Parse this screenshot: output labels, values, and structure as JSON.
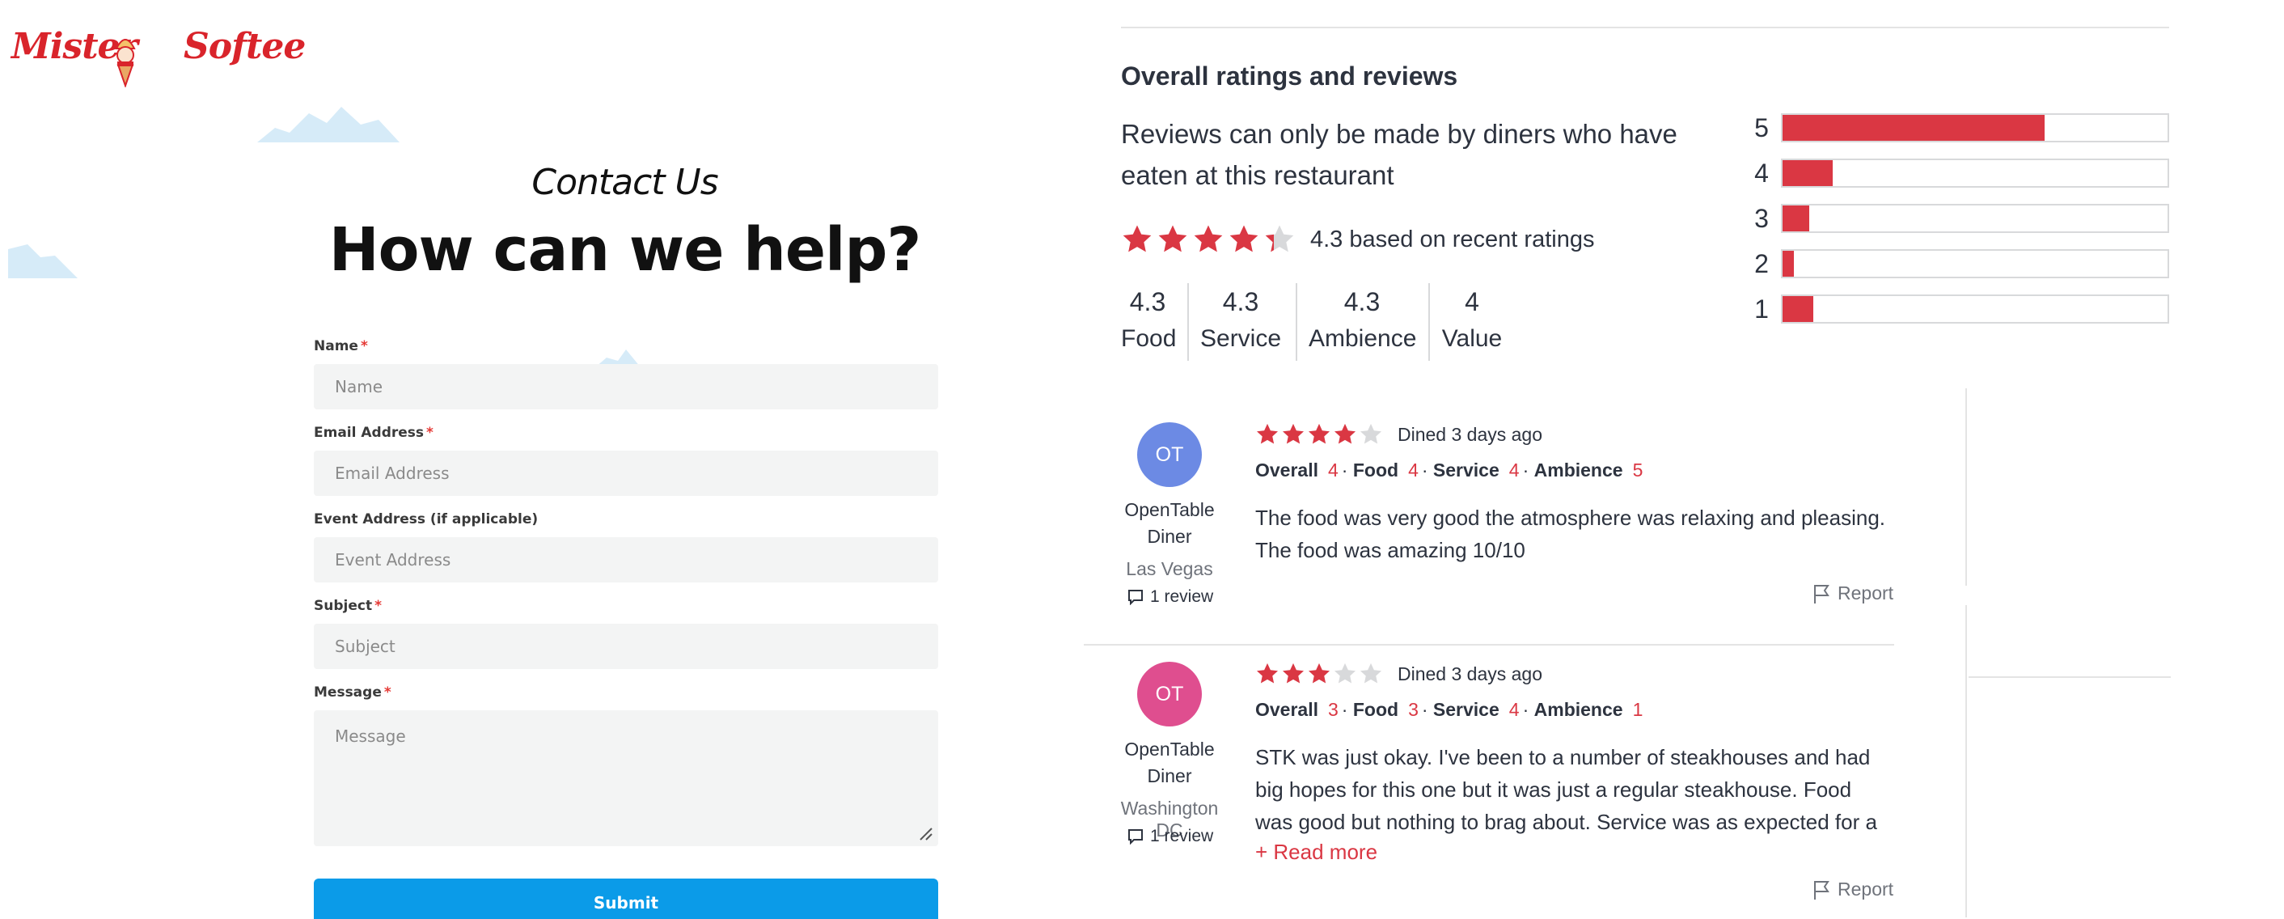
{
  "brand": {
    "logo_text": "Mister Softee",
    "accent": "#d9242b"
  },
  "contact": {
    "kicker": "Contact Us",
    "title": "How can we help?",
    "fields": [
      {
        "label": "Name",
        "required": true,
        "placeholder": "Name"
      },
      {
        "label": "Email Address",
        "required": true,
        "placeholder": "Email Address"
      },
      {
        "label": "Event Address (if applicable)",
        "required": false,
        "placeholder": "Event Address"
      },
      {
        "label": "Subject",
        "required": true,
        "placeholder": "Subject"
      },
      {
        "label": "Message",
        "required": true,
        "placeholder": "Message"
      }
    ],
    "required_mark": "*",
    "submit_label": "Submit",
    "submit_color": "#0b9be8"
  },
  "ratings": {
    "section_title": "Overall ratings and reviews",
    "intro": "Reviews can only be made by diners who have eaten at this restaurant",
    "overall_stars": 4.3,
    "overall_text": "4.3 based on recent ratings",
    "categories": [
      {
        "value": "4.3",
        "label": "Food"
      },
      {
        "value": "4.3",
        "label": "Service"
      },
      {
        "value": "4.3",
        "label": "Ambience"
      },
      {
        "value": "4",
        "label": "Value"
      }
    ],
    "distribution": [
      {
        "stars": "5",
        "fraction": 0.68
      },
      {
        "stars": "4",
        "fraction": 0.13
      },
      {
        "stars": "3",
        "fraction": 0.07
      },
      {
        "stars": "2",
        "fraction": 0.03
      },
      {
        "stars": "1",
        "fraction": 0.08
      }
    ],
    "star_color": "#da3743",
    "star_empty_color": "#d8d9db"
  },
  "reviews": [
    {
      "initials": "OT",
      "avatar_color": "#6c8ae4",
      "name": "OpenTable Diner",
      "location": "Las Vegas",
      "review_count": "1 review",
      "stars": 4,
      "dined": "Dined 3 days ago",
      "overall_label": "Overall",
      "overall": "4",
      "food_label": "Food",
      "food": "4",
      "service_label": "Service",
      "service": "4",
      "ambience_label": "Ambience",
      "ambience": "5",
      "text": "The food was very good the atmosphere was relaxing and pleasing. The food was amazing 10/10",
      "read_more": "",
      "report": "Report"
    },
    {
      "initials": "OT",
      "avatar_color": "#df4e8f",
      "name": "OpenTable Diner",
      "location": "Washington DC",
      "review_count": "1 review",
      "stars": 3,
      "dined": "Dined 3 days ago",
      "overall_label": "Overall",
      "overall": "3",
      "food_label": "Food",
      "food": "3",
      "service_label": "Service",
      "service": "4",
      "ambience_label": "Ambience",
      "ambience": "1",
      "text": "STK was just okay. I've been to a number of steakhouses and had big hopes for this one but it was just a regular steakhouse. Food was good but nothing to brag about. Service was as expected for a steakhouse...",
      "read_more": "+ Read more",
      "report": "Report"
    }
  ],
  "icons": {
    "star": "star-icon",
    "review_count": "speech-bubble-icon",
    "report": "flag-icon",
    "resize": "resize-grip-icon"
  }
}
